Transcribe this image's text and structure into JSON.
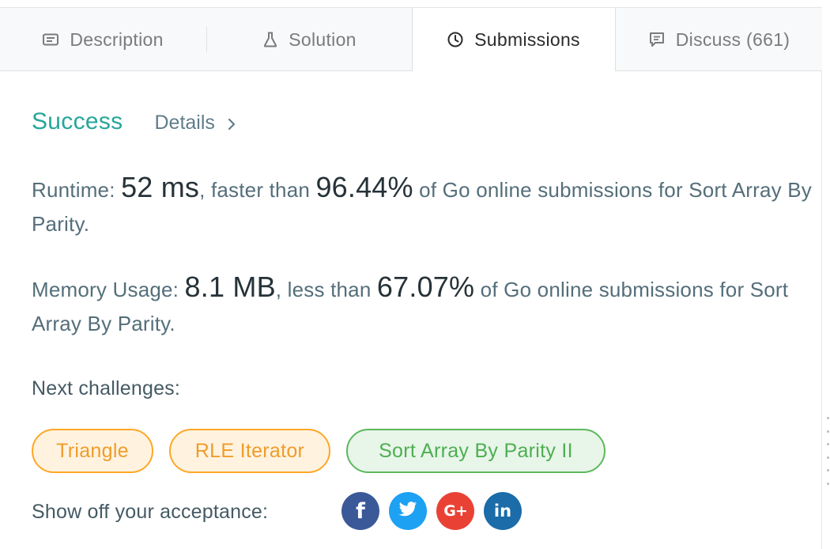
{
  "tabs": [
    {
      "label": "Description",
      "icon": "description-icon"
    },
    {
      "label": "Solution",
      "icon": "flask-icon"
    },
    {
      "label": "Submissions",
      "icon": "clock-icon",
      "active": true
    },
    {
      "label": "Discuss (661)",
      "icon": "comment-icon"
    }
  ],
  "result": {
    "status": "Success",
    "details_label": "Details",
    "status_color": "#26a69a"
  },
  "runtime": {
    "prefix": "Runtime: ",
    "value": "52 ms",
    "comparison": ", faster than ",
    "percent": "96.44%",
    "suffix": " of Go online submissions for Sort Array By Parity."
  },
  "memory": {
    "prefix": "Memory Usage: ",
    "value": "8.1 MB",
    "comparison": ", less than ",
    "percent": "67.07%",
    "suffix": " of Go online submissions for Sort Array By Parity."
  },
  "next_challenges": {
    "label": "Next challenges:",
    "items": [
      {
        "title": "Triangle",
        "difficulty_color": "#ffa726"
      },
      {
        "title": "RLE Iterator",
        "difficulty_color": "#ffa726"
      },
      {
        "title": "Sort Array By Parity II",
        "difficulty_color": "#5cb85c"
      }
    ]
  },
  "share": {
    "label": "Show off your acceptance:",
    "networks": [
      {
        "glyph": "f",
        "icon": "facebook-icon",
        "color": "#3b5998"
      },
      {
        "glyph": "",
        "icon": "twitter-icon",
        "color": "#1da1f2"
      },
      {
        "glyph": "G+",
        "icon": "google-plus-icon",
        "color": "#e94235"
      },
      {
        "glyph": "in",
        "icon": "linkedin-icon",
        "color": "#1b6ca8"
      }
    ]
  }
}
